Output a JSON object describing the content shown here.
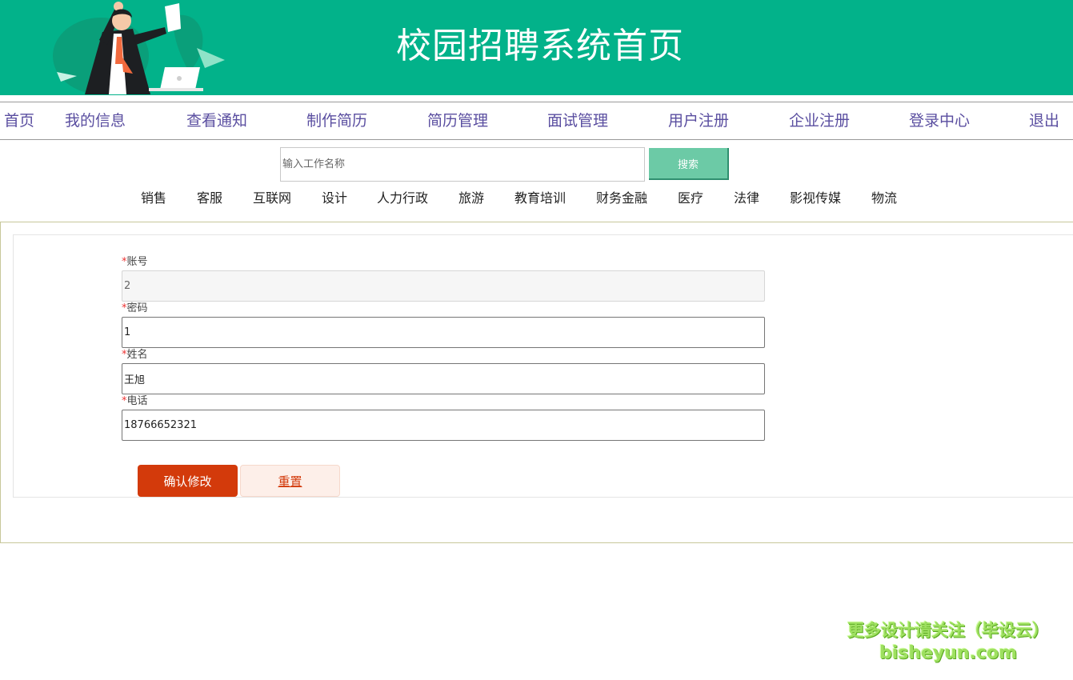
{
  "header": {
    "title": "校园招聘系统首页"
  },
  "nav": {
    "items": [
      "首页",
      "我的信息",
      "查看通知",
      "制作简历",
      "简历管理",
      "面试管理",
      "用户注册",
      "企业注册",
      "登录中心",
      "退出"
    ]
  },
  "search": {
    "placeholder": "输入工作名称",
    "value": "",
    "button_label": "搜索"
  },
  "categories": [
    "销售",
    "客服",
    "互联网",
    "设计",
    "人力行政",
    "旅游",
    "教育培训",
    "财务金融",
    "医疗",
    "法律",
    "影视传媒",
    "物流"
  ],
  "form": {
    "required_mark": "*",
    "fields": [
      {
        "label": "账号",
        "value": "2"
      },
      {
        "label": "密码",
        "value": "1"
      },
      {
        "label": "姓名",
        "value": "王旭"
      },
      {
        "label": "电话",
        "value": "18766652321"
      }
    ],
    "confirm_label": "确认修改",
    "reset_label": "重置"
  },
  "watermark": {
    "line1": "更多设计请关注（毕设云）",
    "line2": "bisheyun.com"
  },
  "colors": {
    "banner": "#02b28a",
    "nav_text": "#5a4ea0",
    "search_button": "#6ccaa6",
    "confirm_button": "#d33a0b",
    "reset_button_bg": "#fdefe9"
  }
}
